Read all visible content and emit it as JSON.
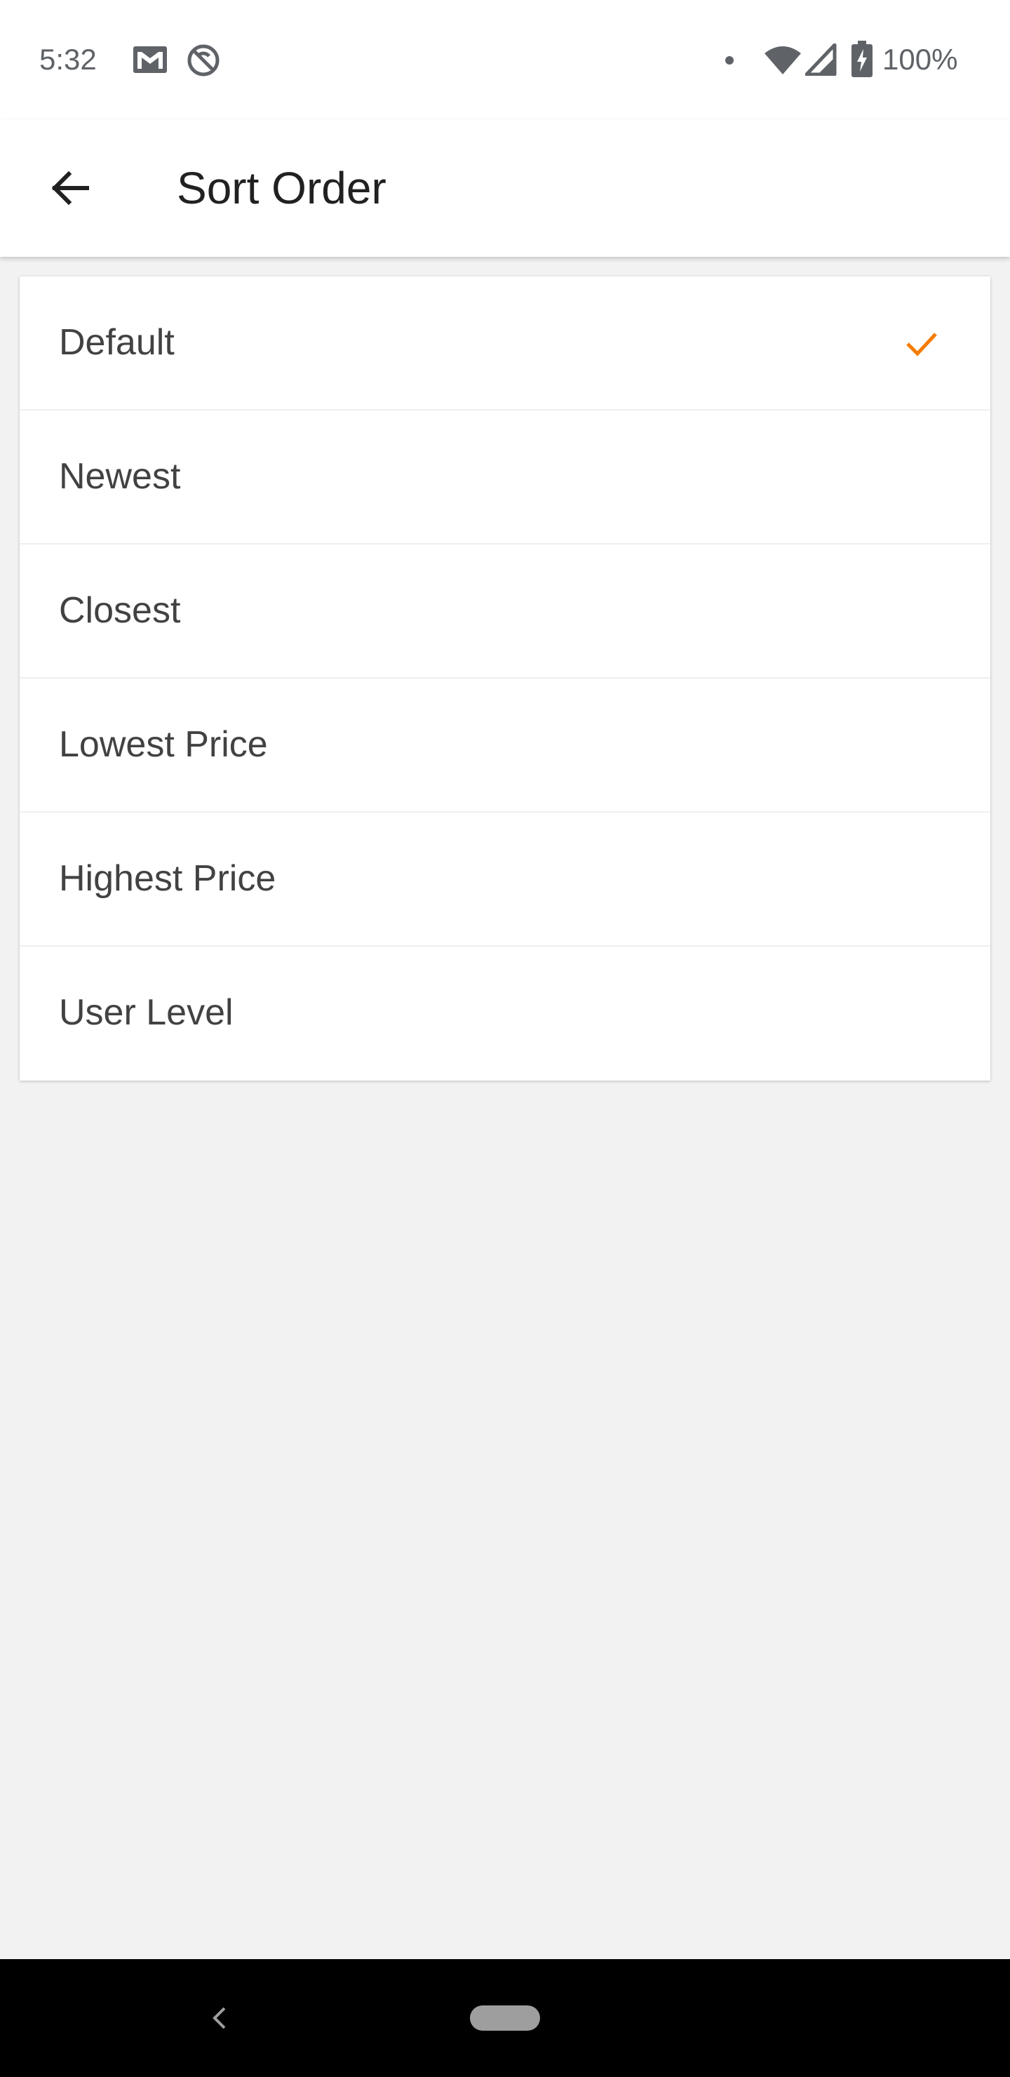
{
  "status_bar": {
    "time": "5:32",
    "battery": "100%",
    "icons": [
      "gmail-icon",
      "sync-disabled-icon",
      "notification-dot-icon",
      "wifi-icon",
      "signal-icon",
      "battery-charging-icon"
    ]
  },
  "app_bar": {
    "title": "Sort Order",
    "back_icon": "arrow-back-icon"
  },
  "sort_options": [
    {
      "label": "Default",
      "selected": true
    },
    {
      "label": "Newest",
      "selected": false
    },
    {
      "label": "Closest",
      "selected": false
    },
    {
      "label": "Lowest Price",
      "selected": false
    },
    {
      "label": "Highest Price",
      "selected": false
    },
    {
      "label": "User Level",
      "selected": false
    }
  ],
  "colors": {
    "accent": "#f57c00",
    "background": "#f2f2f2",
    "surface": "#ffffff",
    "text_primary": "#212121",
    "text_item": "#424242"
  },
  "nav_bar": {
    "icons": [
      "nav-back-icon",
      "home-pill-icon"
    ]
  }
}
